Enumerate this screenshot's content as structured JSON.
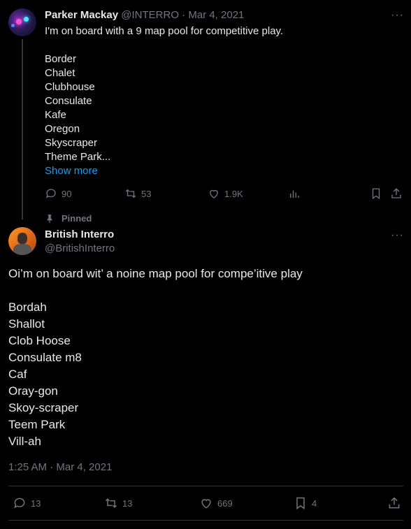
{
  "parent_tweet": {
    "author_name": "Parker Mackay",
    "handle": "@INTERRO",
    "separator": "·",
    "date": "Mar 4, 2021",
    "text_first_line": "I'm on board with a 9 map pool for competitive play.",
    "maps": [
      "Border",
      "Chalet",
      "Clubhouse",
      "Consulate",
      "Kafe",
      "Oregon",
      "Skyscraper",
      "Theme Park..."
    ],
    "show_more": "Show more",
    "stats": {
      "replies": "90",
      "retweets": "53",
      "likes": "1.9K"
    }
  },
  "pinned_label": "Pinned",
  "main_tweet": {
    "author_name": "British Interro",
    "handle": "@BritishInterro",
    "text_first_line": "Oi’m on board wit’ a noine map pool for compe’itive play",
    "maps": [
      "Bordah",
      "Shallot",
      "Clob Hoose",
      "Consulate m8",
      "Caf",
      "Oray-gon",
      "Skoy-scraper",
      "Teem Park",
      "Vill-ah"
    ],
    "timestamp": "1:25 AM · Mar 4, 2021",
    "stats": {
      "replies": "13",
      "retweets": "13",
      "likes": "669",
      "bookmarks": "4"
    }
  },
  "more_menu_glyph": "···",
  "colors": {
    "background": "#000000",
    "text": "#e7e9ea",
    "muted": "#71767b",
    "link": "#1d9bf0",
    "divider": "#2f3336"
  }
}
